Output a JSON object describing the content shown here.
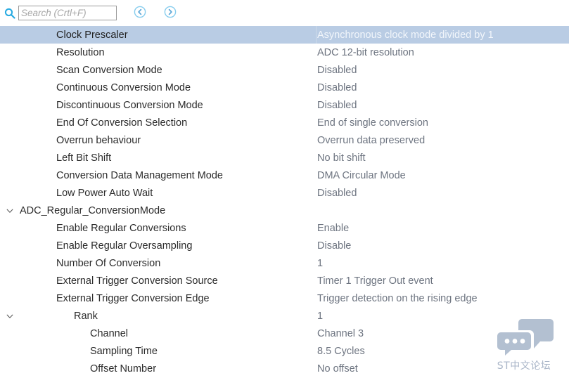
{
  "toolbar": {
    "search_icon": "search-icon",
    "search_placeholder": "Search (Crtl+F)",
    "search_value": "",
    "prev_button_label": "‹",
    "prev_icon": "chevron-left-circle-icon",
    "next_button_label": "›",
    "next_icon": "chevron-right-circle-icon"
  },
  "colors": {
    "selection_background": "#b9cce4",
    "accent_blue": "#7fc0e8",
    "label_text": "#2b2b2b",
    "value_text": "#6d7480",
    "watermark": "#b3c0d1"
  },
  "tree": {
    "rows": [
      {
        "label": "Clock Prescaler",
        "value": "Asynchronous clock mode divided by 1",
        "level": "item",
        "type": "property",
        "selected": true,
        "expandable": false
      },
      {
        "label": "Resolution",
        "value": "ADC 12-bit resolution",
        "level": "item",
        "type": "property",
        "selected": false,
        "expandable": false
      },
      {
        "label": "Scan Conversion Mode",
        "value": "Disabled",
        "level": "item",
        "type": "property",
        "selected": false,
        "expandable": false
      },
      {
        "label": "Continuous Conversion Mode",
        "value": "Disabled",
        "level": "item",
        "type": "property",
        "selected": false,
        "expandable": false
      },
      {
        "label": "Discontinuous Conversion Mode",
        "value": "Disabled",
        "level": "item",
        "type": "property",
        "selected": false,
        "expandable": false
      },
      {
        "label": "End Of Conversion Selection",
        "value": "End of single conversion",
        "level": "item",
        "type": "property",
        "selected": false,
        "expandable": false
      },
      {
        "label": "Overrun behaviour",
        "value": "Overrun data preserved",
        "level": "item",
        "type": "property",
        "selected": false,
        "expandable": false
      },
      {
        "label": "Left Bit Shift",
        "value": "No bit shift",
        "level": "item",
        "type": "property",
        "selected": false,
        "expandable": false
      },
      {
        "label": "Conversion Data Management Mode",
        "value": "DMA Circular Mode",
        "level": "item",
        "type": "property",
        "selected": false,
        "expandable": false
      },
      {
        "label": "Low Power Auto Wait",
        "value": "Disabled",
        "level": "item",
        "type": "property",
        "selected": false,
        "expandable": false
      },
      {
        "label": "ADC_Regular_ConversionMode",
        "value": "",
        "level": "group",
        "type": "group",
        "selected": false,
        "expandable": true,
        "expanded": true
      },
      {
        "label": "Enable Regular Conversions",
        "value": "Enable",
        "level": "item",
        "type": "property",
        "selected": false,
        "expandable": false
      },
      {
        "label": "Enable Regular Oversampling",
        "value": "Disable",
        "level": "item",
        "type": "property",
        "selected": false,
        "expandable": false
      },
      {
        "label": "Number Of Conversion",
        "value": "1",
        "level": "item",
        "type": "property",
        "selected": false,
        "expandable": false
      },
      {
        "label": "External Trigger Conversion Source",
        "value": "Timer 1 Trigger Out event",
        "level": "item",
        "type": "property",
        "selected": false,
        "expandable": false
      },
      {
        "label": "External Trigger Conversion Edge",
        "value": "Trigger detection on the rising edge",
        "level": "item",
        "type": "property",
        "selected": false,
        "expandable": false
      },
      {
        "label": "Rank",
        "value": "1",
        "level": "sub",
        "type": "group",
        "selected": false,
        "expandable": true,
        "expanded": true
      },
      {
        "label": "Channel",
        "value": "Channel 3",
        "level": "subitem",
        "type": "property",
        "selected": false,
        "expandable": false
      },
      {
        "label": "Sampling Time",
        "value": "8.5 Cycles",
        "level": "subitem",
        "type": "property",
        "selected": false,
        "expandable": false
      },
      {
        "label": "Offset Number",
        "value": "No offset",
        "level": "subitem",
        "type": "property",
        "selected": false,
        "expandable": false
      }
    ]
  },
  "watermark": {
    "text": "ST中文论坛",
    "icon": "speech-bubbles-icon"
  }
}
